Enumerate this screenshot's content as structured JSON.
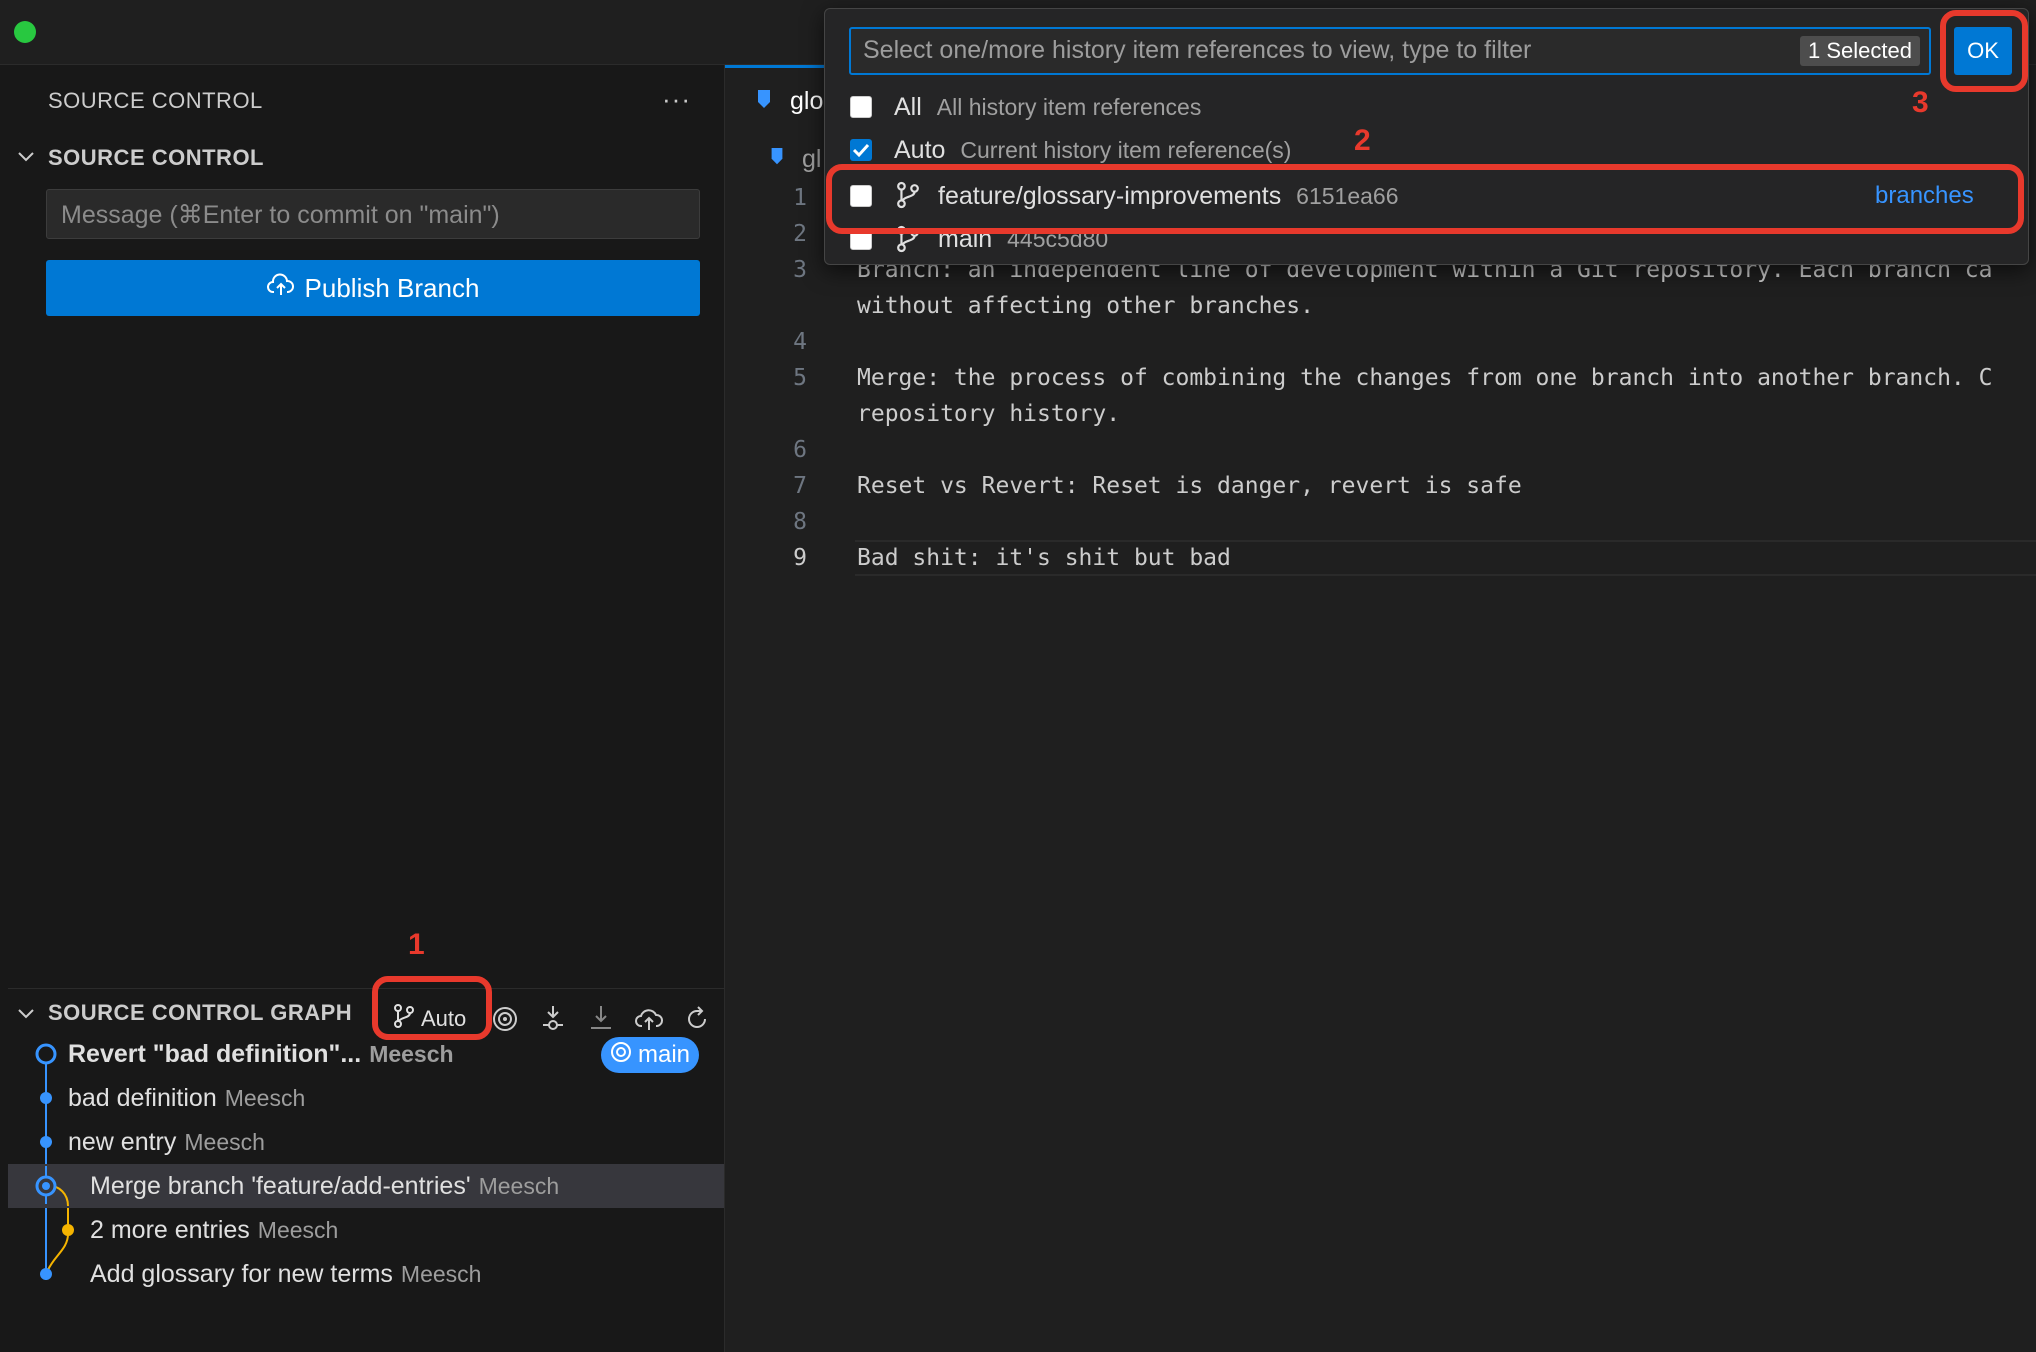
{
  "sidebar": {
    "title": "SOURCE CONTROL",
    "more_label": "···",
    "section_title": "SOURCE CONTROL",
    "commit_placeholder": "Message (⌘Enter to commit on \"main\")",
    "publish_label": "Publish Branch"
  },
  "graph": {
    "title": "SOURCE CONTROL GRAPH",
    "ref_picker_label": "Auto",
    "commits": [
      {
        "message": "Revert \"bad definition\"...",
        "author": "Meesch"
      },
      {
        "message": "bad definition",
        "author": "Meesch"
      },
      {
        "message": "new entry",
        "author": "Meesch"
      },
      {
        "message": "Merge branch 'feature/add-entries'",
        "author": "Meesch"
      },
      {
        "message": "2 more entries",
        "author": "Meesch"
      },
      {
        "message": "Add glossary for new terms",
        "author": "Meesch"
      }
    ],
    "head_badge": "main"
  },
  "editor": {
    "tab_label": "glo",
    "breadcrumb": "gl",
    "line_numbers": [
      "1",
      "2",
      "3",
      "4",
      "5",
      "6",
      "7",
      "8",
      "9"
    ],
    "lines": {
      "l3a": "Branch: an independent line of development within a Git repository. Each branch ca",
      "l3b": "without affecting other branches.",
      "l5a": "Merge: the process of combining the changes from one branch into another branch. C",
      "l5b": "repository history.",
      "l7": "Reset vs Revert: Reset is danger, revert is safe",
      "l9": "Bad shit: it's shit but bad"
    }
  },
  "quick_pick": {
    "placeholder": "Select one/more history item references to view, type to filter",
    "selected_count": "1 Selected",
    "ok_label": "OK",
    "items": [
      {
        "label": "All",
        "description": "All history item references",
        "checked": false
      },
      {
        "label": "Auto",
        "description": "Current history item reference(s)",
        "checked": true
      },
      {
        "label": "feature/glossary-improvements",
        "description": "6151ea66",
        "group": "branches",
        "checked": false
      },
      {
        "label": "main",
        "description": "445c5d80",
        "checked": false
      }
    ]
  },
  "annotations": {
    "one": "1",
    "two": "2",
    "three": "3"
  },
  "colors": {
    "accent": "#0078d4",
    "annotation_red": "#e8392c",
    "graph_blue": "#3794ff",
    "graph_yellow": "#f5b400"
  }
}
